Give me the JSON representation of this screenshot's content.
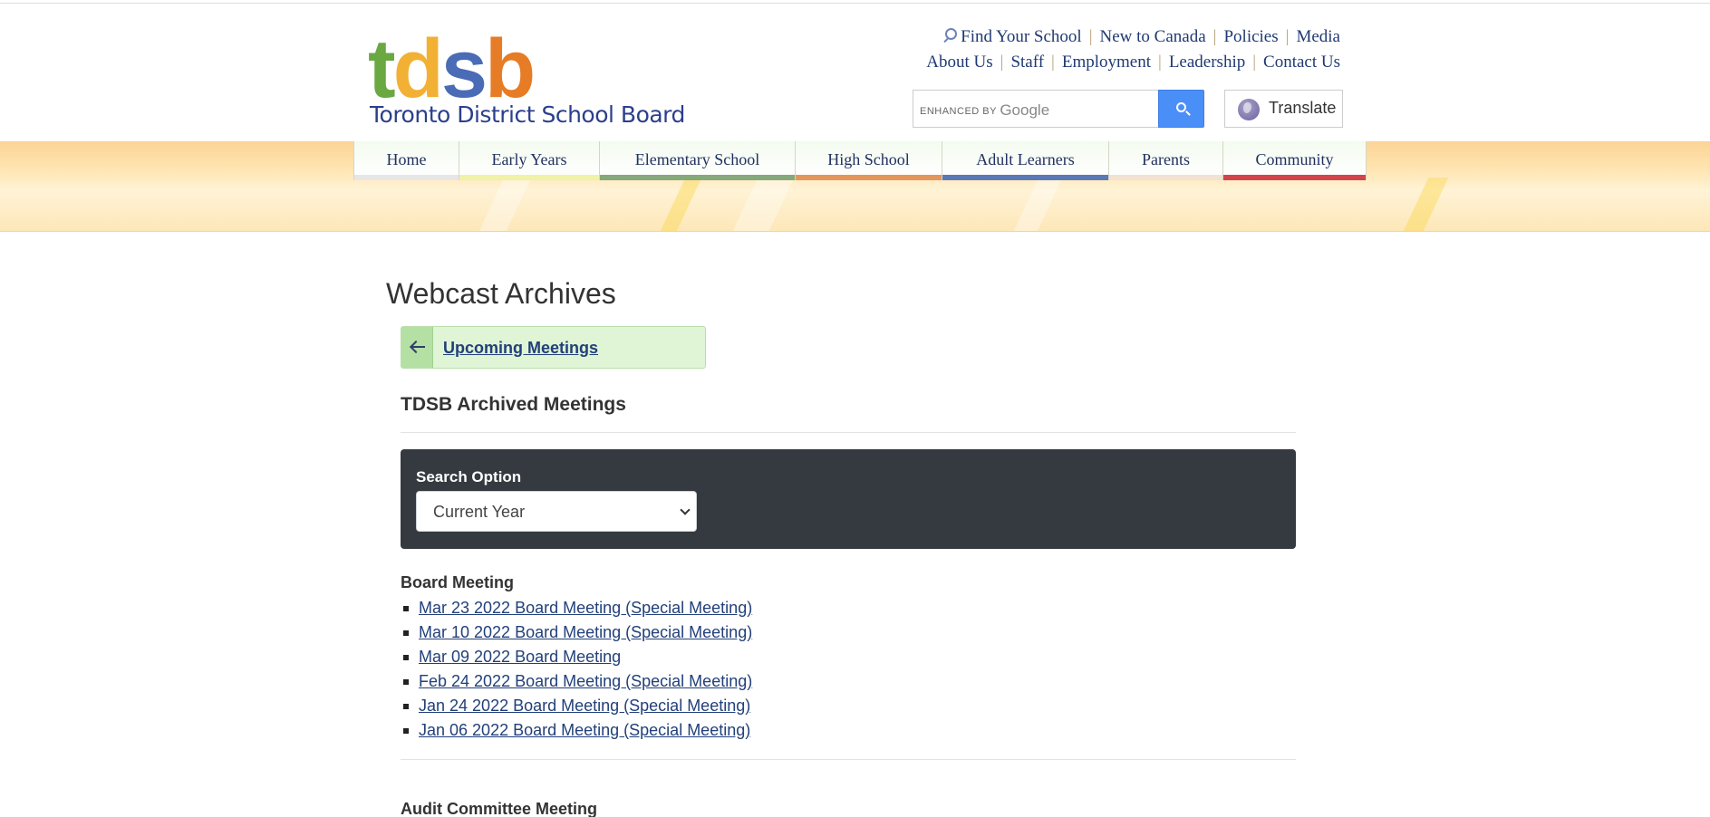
{
  "header": {
    "logo_letters": [
      {
        "char": "t",
        "color": "#6aa842"
      },
      {
        "char": "d",
        "color": "#f2b134"
      },
      {
        "char": "s",
        "color": "#4a6bb5"
      },
      {
        "char": "b",
        "color": "#e67c25"
      }
    ],
    "logo_subtitle": "Toronto District School Board",
    "utility_links_row1": [
      "Find Your School",
      "New to Canada",
      "Policies",
      "Media"
    ],
    "utility_links_row2": [
      "About Us",
      "Staff",
      "Employment",
      "Leadership",
      "Contact Us"
    ],
    "search": {
      "brand_prefix": "ENHANCED BY",
      "brand_name": "Google",
      "icon": "search-icon"
    },
    "translate_label": "Translate"
  },
  "nav": {
    "items": [
      {
        "label": "Home",
        "color": "#e6e6e6"
      },
      {
        "label": "Early Years",
        "color": "#f0f2a6"
      },
      {
        "label": "Elementary School",
        "color": "#84a97a"
      },
      {
        "label": "High School",
        "color": "#e4965a"
      },
      {
        "label": "Adult Learners",
        "color": "#5a79b6"
      },
      {
        "label": "Parents",
        "color": "#f3e2d2"
      },
      {
        "label": "Community",
        "color": "#d4424b"
      }
    ]
  },
  "main": {
    "page_title": "Webcast Archives",
    "back_link": "Upcoming Meetings",
    "section_title": "TDSB Archived Meetings",
    "search_panel": {
      "label": "Search Option",
      "selected": "Current Year"
    },
    "groups": [
      {
        "title": "Board Meeting",
        "meetings": [
          "Mar 23 2022 Board Meeting (Special Meeting)",
          "Mar 10 2022 Board Meeting (Special Meeting)",
          "Mar 09 2022 Board Meeting",
          "Feb 24 2022 Board Meeting (Special Meeting)",
          "Jan 24 2022 Board Meeting (Special Meeting)",
          "Jan 06 2022 Board Meeting (Special Meeting)"
        ]
      },
      {
        "title": "Audit Committee Meeting",
        "meetings": []
      }
    ]
  }
}
